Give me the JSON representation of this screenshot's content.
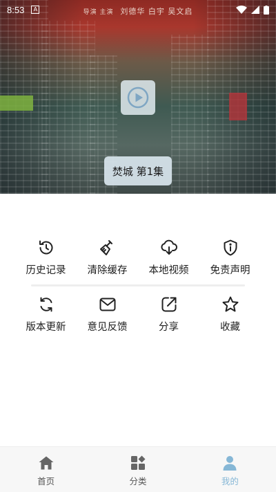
{
  "status_bar": {
    "time": "8:53",
    "indicator": "A"
  },
  "poster": {
    "credits": "导演 主演",
    "cast": "刘德华 白宇 吴文启"
  },
  "player": {
    "episode_label": "焚城 第1集"
  },
  "menu": {
    "row1": [
      {
        "label": "历史记录",
        "icon": "history-icon"
      },
      {
        "label": "清除缓存",
        "icon": "broom-icon"
      },
      {
        "label": "本地视频",
        "icon": "cloud-download-icon"
      },
      {
        "label": "免责声明",
        "icon": "shield-info-icon"
      }
    ],
    "row2": [
      {
        "label": "版本更新",
        "icon": "refresh-icon"
      },
      {
        "label": "意见反馈",
        "icon": "mail-icon"
      },
      {
        "label": "分享",
        "icon": "share-icon"
      },
      {
        "label": "收藏",
        "icon": "star-icon"
      }
    ]
  },
  "bottom_nav": {
    "items": [
      {
        "label": "首页",
        "icon": "home-icon"
      },
      {
        "label": "分类",
        "icon": "category-icon"
      },
      {
        "label": "我的",
        "icon": "user-icon",
        "active": true
      }
    ]
  },
  "colors": {
    "accent": "#86b7d6",
    "icon": "#222222"
  }
}
